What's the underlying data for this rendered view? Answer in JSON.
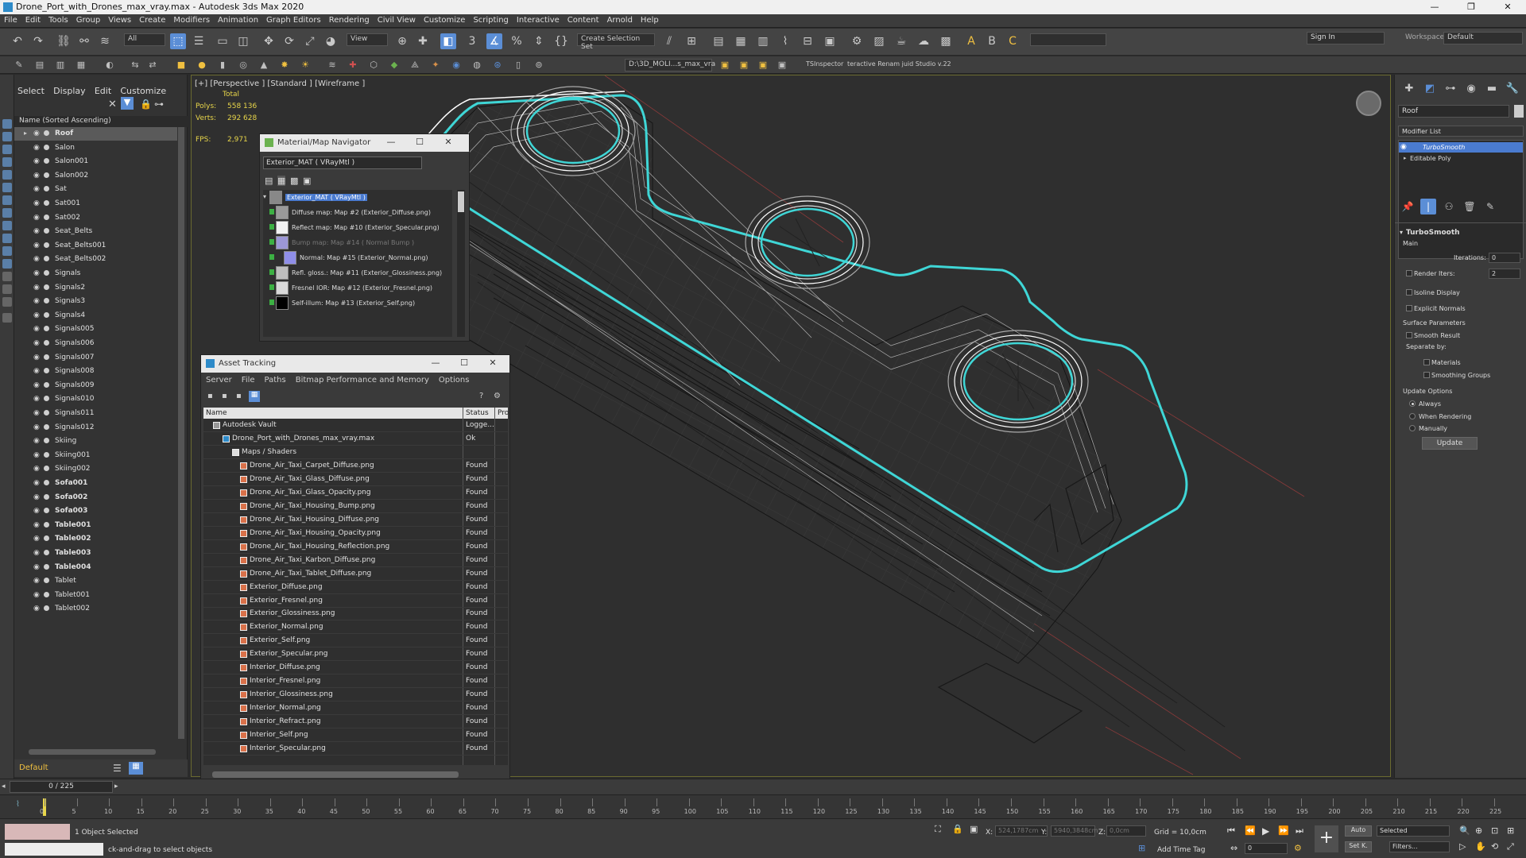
{
  "title_bar": {
    "title": "Drone_Port_with_Drones_max_vray.max - Autodesk 3ds Max 2020",
    "minimize": "—",
    "maximize": "❐",
    "close": "✕"
  },
  "menu": [
    "File",
    "Edit",
    "Tools",
    "Group",
    "Views",
    "Create",
    "Modifiers",
    "Animation",
    "Graph Editors",
    "Rendering",
    "Civil View",
    "Customize",
    "Scripting",
    "Interactive",
    "Content",
    "Arnold",
    "Help"
  ],
  "toolbar": {
    "selection_filter": "All",
    "ref_coord": "View",
    "selection_set": "Create Selection Set",
    "sign_in": "Sign In",
    "workspaces_label": "Workspaces:",
    "workspace_value": "Default",
    "path_field": "D:\\3D_MOLI...s_max_vra",
    "plugin1": "TSInspector",
    "plugin2": "teractive Renam juid Studio v.22"
  },
  "explorer": {
    "tabs": [
      "Select",
      "Display",
      "Edit",
      "Customize"
    ],
    "header": "Name (Sorted Ascending)",
    "items": [
      {
        "name": "Roof",
        "bold": true,
        "selected": true
      },
      {
        "name": "Salon",
        "bold": false
      },
      {
        "name": "Salon001",
        "bold": false
      },
      {
        "name": "Salon002",
        "bold": false
      },
      {
        "name": "Sat",
        "bold": false
      },
      {
        "name": "Sat001",
        "bold": false
      },
      {
        "name": "Sat002",
        "bold": false
      },
      {
        "name": "Seat_Belts",
        "bold": false
      },
      {
        "name": "Seat_Belts001",
        "bold": false
      },
      {
        "name": "Seat_Belts002",
        "bold": false
      },
      {
        "name": "Signals",
        "bold": false
      },
      {
        "name": "Signals2",
        "bold": false
      },
      {
        "name": "Signals3",
        "bold": false
      },
      {
        "name": "Signals4",
        "bold": false
      },
      {
        "name": "Signals005",
        "bold": false
      },
      {
        "name": "Signals006",
        "bold": false
      },
      {
        "name": "Signals007",
        "bold": false
      },
      {
        "name": "Signals008",
        "bold": false
      },
      {
        "name": "Signals009",
        "bold": false
      },
      {
        "name": "Signals010",
        "bold": false
      },
      {
        "name": "Signals011",
        "bold": false
      },
      {
        "name": "Signals012",
        "bold": false
      },
      {
        "name": "Skiing",
        "bold": false
      },
      {
        "name": "Skiing001",
        "bold": false
      },
      {
        "name": "Skiing002",
        "bold": false
      },
      {
        "name": "Sofa001",
        "bold": true
      },
      {
        "name": "Sofa002",
        "bold": true
      },
      {
        "name": "Sofa003",
        "bold": true
      },
      {
        "name": "Table001",
        "bold": true
      },
      {
        "name": "Table002",
        "bold": true
      },
      {
        "name": "Table003",
        "bold": true
      },
      {
        "name": "Table004",
        "bold": true
      },
      {
        "name": "Tablet",
        "bold": false
      },
      {
        "name": "Tablet001",
        "bold": false
      },
      {
        "name": "Tablet002",
        "bold": false
      }
    ],
    "layer": "Default"
  },
  "viewport": {
    "label": "[+] [Perspective ] [Standard ] [Wireframe ]",
    "total_label": "Total",
    "polys_label": "Polys:",
    "polys_value": "558 136",
    "verts_label": "Verts:",
    "verts_value": "292 628",
    "fps_label": "FPS:",
    "fps_value": "2,971",
    "wire_color": "#3fd6d6"
  },
  "material_navigator": {
    "title": "Material/Map Navigator",
    "field": "Exterior_MAT  ( VRayMtl )",
    "root": "Exterior_MAT  ( VRayMtl )",
    "maps": [
      {
        "label": "Diffuse map: Map #2 (Exterior_Diffuse.png)",
        "thumb": "#9a9a9a",
        "dim": false
      },
      {
        "label": "Reflect map: Map #10 (Exterior_Specular.png)",
        "thumb": "#f2f2f2",
        "dim": false
      },
      {
        "label": "Bump map: Map #14  ( Normal Bump )",
        "thumb": "#9c97d6",
        "dim": true
      },
      {
        "label": "Normal: Map #15 (Exterior_Normal.png)",
        "thumb": "#8f8ee8",
        "dim": false
      },
      {
        "label": "Refl. gloss.: Map #11 (Exterior_Glossiness.png)",
        "thumb": "#bdbdbd",
        "dim": false
      },
      {
        "label": "Fresnel IOR: Map #12 (Exterior_Fresnel.png)",
        "thumb": "#d9d9d9",
        "dim": false
      },
      {
        "label": "Self-illum: Map #13 (Exterior_Self.png)",
        "thumb": "#000000",
        "dim": false
      }
    ]
  },
  "asset_tracking": {
    "title": "Asset Tracking",
    "menu": [
      "Server",
      "File",
      "Paths",
      "Bitmap Performance and Memory",
      "Options"
    ],
    "col_name": "Name",
    "col_status": "Status",
    "col_pro": "Pro",
    "vault": "Autodesk Vault",
    "vault_status": "Logge...",
    "scene": "Drone_Port_with_Drones_max_vray.max",
    "scene_status": "Ok",
    "folder": "Maps / Shaders",
    "files": [
      {
        "name": "Drone_Air_Taxi_Carpet_Diffuse.png",
        "status": "Found"
      },
      {
        "name": "Drone_Air_Taxi_Glass_Diffuse.png",
        "status": "Found"
      },
      {
        "name": "Drone_Air_Taxi_Glass_Opacity.png",
        "status": "Found"
      },
      {
        "name": "Drone_Air_Taxi_Housing_Bump.png",
        "status": "Found"
      },
      {
        "name": "Drone_Air_Taxi_Housing_Diffuse.png",
        "status": "Found"
      },
      {
        "name": "Drone_Air_Taxi_Housing_Opacity.png",
        "status": "Found"
      },
      {
        "name": "Drone_Air_Taxi_Housing_Reflection.png",
        "status": "Found"
      },
      {
        "name": "Drone_Air_Taxi_Karbon_Diffuse.png",
        "status": "Found"
      },
      {
        "name": "Drone_Air_Taxi_Tablet_Diffuse.png",
        "status": "Found"
      },
      {
        "name": "Exterior_Diffuse.png",
        "status": "Found"
      },
      {
        "name": "Exterior_Fresnel.png",
        "status": "Found"
      },
      {
        "name": "Exterior_Glossiness.png",
        "status": "Found"
      },
      {
        "name": "Exterior_Normal.png",
        "status": "Found"
      },
      {
        "name": "Exterior_Self.png",
        "status": "Found"
      },
      {
        "name": "Exterior_Specular.png",
        "status": "Found"
      },
      {
        "name": "Interior_Diffuse.png",
        "status": "Found"
      },
      {
        "name": "Interior_Fresnel.png",
        "status": "Found"
      },
      {
        "name": "Interior_Glossiness.png",
        "status": "Found"
      },
      {
        "name": "Interior_Normal.png",
        "status": "Found"
      },
      {
        "name": "Interior_Refract.png",
        "status": "Found"
      },
      {
        "name": "Interior_Self.png",
        "status": "Found"
      },
      {
        "name": "Interior_Specular.png",
        "status": "Found"
      }
    ]
  },
  "command_panel": {
    "object_name": "Roof",
    "modifier_list": "Modifier List",
    "stack": [
      "TurboSmooth",
      "Editable Poly"
    ],
    "rollout_title": "TurboSmooth",
    "main": "Main",
    "iterations_label": "Iterations:",
    "iterations_value": "0",
    "render_iters_label": "Render Iters:",
    "render_iters_value": "2",
    "isoline": "Isoline Display",
    "explicit_normals": "Explicit Normals",
    "surface_params": "Surface Parameters",
    "smooth_result": "Smooth Result",
    "separate_by": "Separate by:",
    "materials": "Materials",
    "smoothing_groups": "Smoothing Groups",
    "update_options": "Update Options",
    "always": "Always",
    "when_rendering": "When Rendering",
    "manually": "Manually",
    "update_btn": "Update"
  },
  "timeline": {
    "frame_display": "0 / 225",
    "ticks": [
      "0",
      "5",
      "10",
      "15",
      "20",
      "25",
      "30",
      "35",
      "40",
      "45",
      "50",
      "55",
      "60",
      "65",
      "70",
      "75",
      "80",
      "85",
      "90",
      "95",
      "100",
      "105",
      "110",
      "115",
      "120",
      "125",
      "130",
      "135",
      "140",
      "145",
      "150",
      "155",
      "160",
      "165",
      "170",
      "175",
      "180",
      "185",
      "190",
      "195",
      "200",
      "205",
      "210",
      "215",
      "220",
      "225"
    ]
  },
  "status": {
    "selection": "1 Object Selected",
    "prompt": "ck-and-drag to select objects",
    "x_label": "X:",
    "x_value": "524,1787cm",
    "y_label": "Y:",
    "y_value": "5940,3848cm",
    "z_label": "Z:",
    "z_value": "0,0cm",
    "grid": "Grid = 10,0cm",
    "add_time_tag": "Add Time Tag",
    "auto": "Auto",
    "set_k": "Set K.",
    "selected_dd": "Selected",
    "filters": "Filters...",
    "frame_field": "0"
  }
}
